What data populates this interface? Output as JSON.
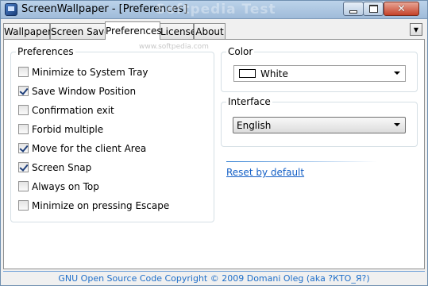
{
  "window": {
    "title": "ScreenWallpaper - [Preferences]",
    "watermark": "Softpedia Test",
    "close_glyph": "✕"
  },
  "tabs": [
    {
      "label": "Wallpaper"
    },
    {
      "label": "Screen Save"
    },
    {
      "label": "Preferences"
    },
    {
      "label": "License"
    },
    {
      "label": "About"
    }
  ],
  "active_tab": "Preferences",
  "panel": {
    "softpedia_mark": "www.softpedia.com"
  },
  "preferences": {
    "group_label": "Preferences",
    "options": [
      {
        "label": "Minimize to System Tray",
        "checked": false
      },
      {
        "label": "Save Window Position",
        "checked": true
      },
      {
        "label": "Confirmation exit",
        "checked": false
      },
      {
        "label": "Forbid multiple",
        "checked": false
      },
      {
        "label": "Move for the client Area",
        "checked": true
      },
      {
        "label": "Screen Snap",
        "checked": true
      },
      {
        "label": "Always on Top",
        "checked": false
      },
      {
        "label": "Minimize on pressing Escape",
        "checked": false
      }
    ]
  },
  "color": {
    "group_label": "Color",
    "selected": "White",
    "swatch_color": "#ffffff"
  },
  "interface": {
    "group_label": "Interface",
    "selected": "English"
  },
  "reset_link": "Reset by default",
  "status": "GNU Open Source Code  Copyright © 2009 Domani Oleg (aka ?КТО_Я?)",
  "colors": {
    "accent": "#1560c6",
    "status_text": "#1f6fc9"
  }
}
